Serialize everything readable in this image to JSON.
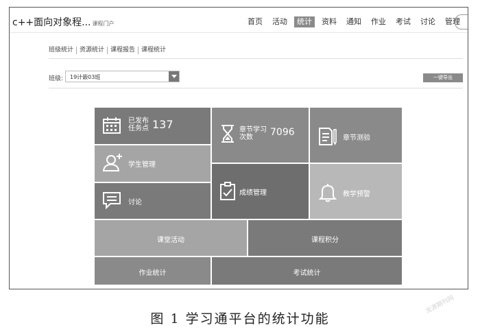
{
  "header": {
    "course_title": "c++面向对象程...",
    "portal_link": "课程门户",
    "nav": [
      "首页",
      "活动",
      "统计",
      "资料",
      "通知",
      "作业",
      "考试",
      "讨论",
      "管理"
    ],
    "nav_active": "统计"
  },
  "subnav": [
    "班级统计",
    "资源统计",
    "课程报告",
    "课程统计"
  ],
  "filter": {
    "class_label": "班级:",
    "class_value": "19计嵌03班",
    "export_label": "一键导出"
  },
  "tiles": {
    "published_tasks": {
      "label_line1": "已发布",
      "label_line2": "任务点",
      "value": "137"
    },
    "chapter_study": {
      "label_line1": "章节学习",
      "label_line2": "次数",
      "value": "7096"
    },
    "chapter_quiz": {
      "label": "章节测验"
    },
    "student_mgmt": {
      "label": "学生管理"
    },
    "discussion": {
      "label": "讨论"
    },
    "grade_mgmt": {
      "label": "成绩管理"
    },
    "teaching_alert": {
      "label": "教学预警"
    },
    "class_activity": {
      "label": "课堂活动"
    },
    "course_points": {
      "label": "课程积分"
    },
    "homework_stats": {
      "label": "作业统计"
    },
    "exam_stats": {
      "label": "考试统计"
    }
  },
  "tile_colors": {
    "dark": "#7a7a7a",
    "medium": "#8a8a8a",
    "light": "#a5a5a5",
    "lighter": "#b8b8b8",
    "darkest": "#6e6e6e"
  },
  "icons": {
    "published_tasks": "calendar-icon",
    "chapter_study": "hourglass-icon",
    "chapter_quiz": "document-pen-icon",
    "student_mgmt": "user-add-icon",
    "discussion": "chat-icon",
    "grade_mgmt": "clipboard-check-icon",
    "teaching_alert": "bell-icon"
  },
  "caption": "图 1   学习通平台的统计功能",
  "watermark": "龙源期刊网"
}
